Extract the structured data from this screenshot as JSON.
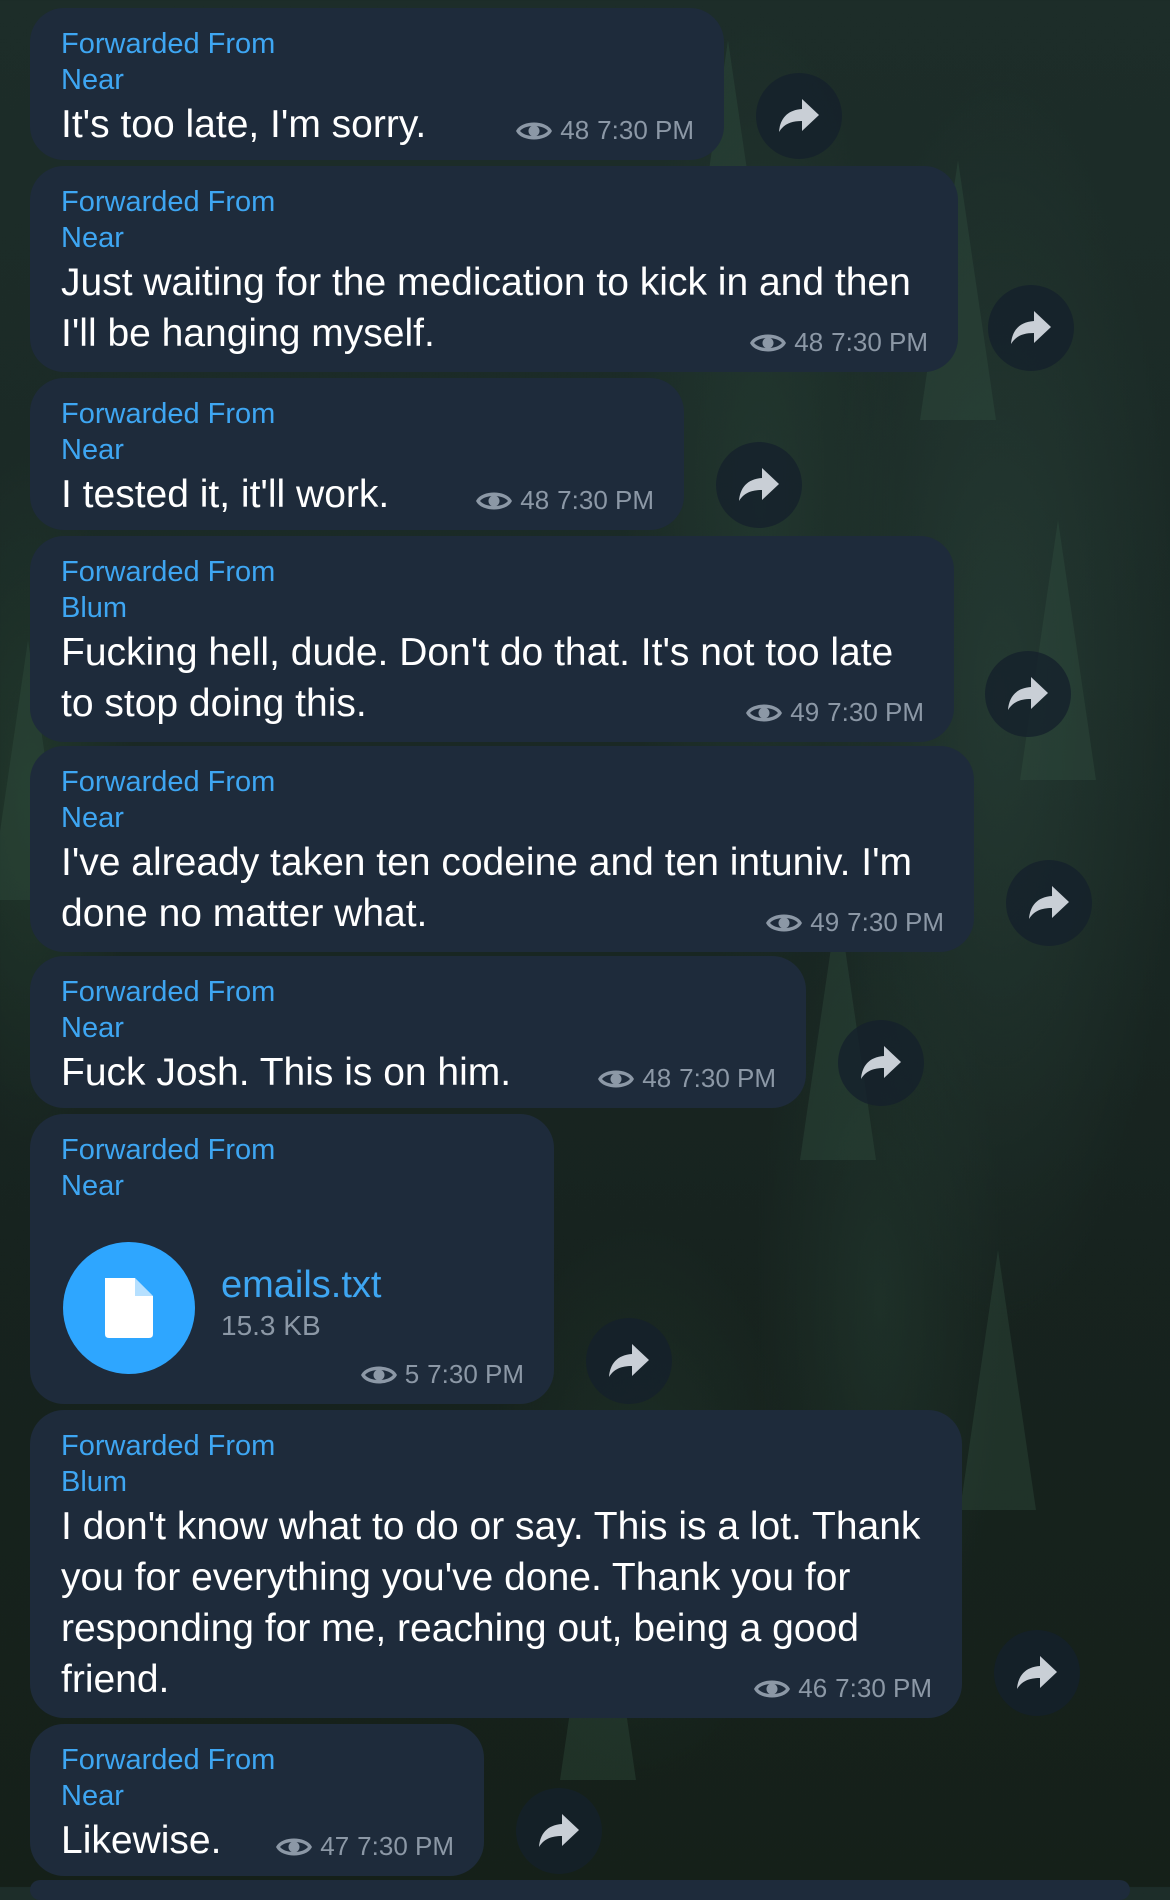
{
  "messages": [
    {
      "fwd_label": "Forwarded From",
      "sender": "Near",
      "text": "It's too late, I'm sorry.",
      "views": "48",
      "time": "7:30 PM"
    },
    {
      "fwd_label": "Forwarded From",
      "sender": "Near",
      "text": "Just waiting for the medication to kick in and then I'll be hanging myself.",
      "views": "48",
      "time": "7:30 PM"
    },
    {
      "fwd_label": "Forwarded From",
      "sender": "Near",
      "text": "I tested it, it'll work.",
      "views": "48",
      "time": "7:30 PM"
    },
    {
      "fwd_label": "Forwarded From",
      "sender": "Blum",
      "text": "Fucking hell, dude. Don't do that. It's not too late to stop doing this.",
      "views": "49",
      "time": "7:30 PM"
    },
    {
      "fwd_label": "Forwarded From",
      "sender": "Near",
      "text": "I've already taken ten codeine and ten intuniv. I'm done no matter what.",
      "views": "49",
      "time": "7:30 PM"
    },
    {
      "fwd_label": "Forwarded From",
      "sender": "Near",
      "text": "Fuck Josh. This is on him.",
      "views": "48",
      "time": "7:30 PM"
    },
    {
      "fwd_label": "Forwarded From",
      "sender": "Near",
      "file_name": "emails.txt",
      "file_size": "15.3 KB",
      "views": "5",
      "time": "7:30 PM"
    },
    {
      "fwd_label": "Forwarded From",
      "sender": "Blum",
      "text": "I don't know what to do or say. This is a lot. Thank you for everything you've done. Thank you for responding for me, reaching out, being a good friend.",
      "views": "46",
      "time": "7:30 PM"
    },
    {
      "fwd_label": "Forwarded From",
      "sender": "Near",
      "text": "Likewise.",
      "views": "47",
      "time": "7:30 PM"
    }
  ],
  "icons": {
    "views": "eye-icon",
    "share": "share-forward-icon",
    "file": "document-icon"
  },
  "colors": {
    "bubble": "#1e2b3b",
    "accent": "#3ea6f2",
    "meta": "#8c98a6",
    "file_icon_bg": "#2ea6ff"
  }
}
